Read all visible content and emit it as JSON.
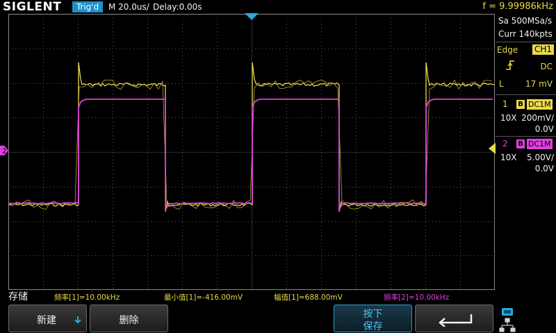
{
  "header": {
    "brand": "SIGLENT",
    "trigger_status": "Trig'd",
    "timebase": "M 20.0us/",
    "delay": "Delay:0.00s",
    "frequency_counter": "f = 9.99986kHz"
  },
  "acquisition": {
    "sample_rate": "Sa 500MSa/s",
    "memory_depth": "Curr 140kpts"
  },
  "trigger": {
    "type": "Edge",
    "source": "CH1",
    "slope_icon": "rising-edge-icon",
    "coupling": "DC",
    "level_label": "L",
    "level": "17 mV"
  },
  "channels": [
    {
      "number": "1",
      "bw_limit": "B",
      "coupling": "DC1M",
      "probe": "10X",
      "scale": "200mV/",
      "offset": "0.0V",
      "color": "#e7d84c"
    },
    {
      "number": "2",
      "bw_limit": "B",
      "coupling": "DC1M",
      "probe": "10X",
      "scale": "5.00V/",
      "offset": "0.0V",
      "color": "#e040e0"
    }
  ],
  "markers": {
    "ch2_ground": "2",
    "trigger_position_icon": "trigger-position-icon",
    "trigger_level_icon": "trigger-level-icon"
  },
  "menu": {
    "title": "存储"
  },
  "measurements": [
    {
      "label": "频率[1]=10.00kHz",
      "color": "#e7d84c"
    },
    {
      "label": "最小值[1]=-416.00mV",
      "color": "#e7d84c"
    },
    {
      "label": "幅值[1]=688.00mV",
      "color": "#e7d84c"
    },
    {
      "label": "频率[2]=10.00kHz",
      "color": "#e040e0"
    }
  ],
  "softkeys": {
    "new_label": "新建",
    "delete_label": "删除",
    "press_save_line1": "按下",
    "press_save_line2": "保存",
    "back_icon": "back-arrow-icon",
    "new_icon": "down-arrow-icon"
  },
  "system_icons": [
    "usb-icon",
    "network-icon"
  ],
  "colors": {
    "ch1": "#e7d84c",
    "ch2": "#e040e0",
    "accent": "#1e8fc8",
    "grid": "#5a5a5a"
  }
}
